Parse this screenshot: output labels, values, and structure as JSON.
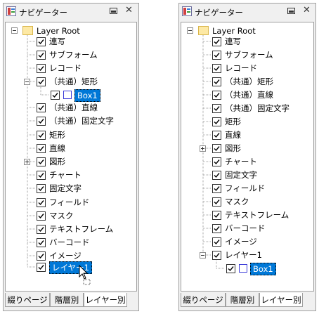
{
  "left_panel": {
    "title": "ナビゲーター",
    "root_label": "Layer Root",
    "items": [
      {
        "label": "連写"
      },
      {
        "label": "サブフォーム"
      },
      {
        "label": "レコード"
      },
      {
        "label": "（共通）矩形"
      },
      {
        "label": "Box1"
      },
      {
        "label": "（共通）直線"
      },
      {
        "label": "（共通）固定文字"
      },
      {
        "label": "矩形"
      },
      {
        "label": "直線"
      },
      {
        "label": "図形"
      },
      {
        "label": "チャート"
      },
      {
        "label": "固定文字"
      },
      {
        "label": "フィールド"
      },
      {
        "label": "マスク"
      },
      {
        "label": "テキストフレーム"
      },
      {
        "label": "バーコード"
      },
      {
        "label": "イメージ"
      },
      {
        "label": "レイヤー1"
      }
    ],
    "tabs": [
      {
        "label": "綴りページ"
      },
      {
        "label": "階層別"
      },
      {
        "label": "レイヤー別"
      }
    ],
    "active_tab": "レイヤー別",
    "selected_item": "Box1"
  },
  "right_panel": {
    "title": "ナビゲーター",
    "root_label": "Layer Root",
    "items": [
      {
        "label": "連写"
      },
      {
        "label": "サブフォーム"
      },
      {
        "label": "レコード"
      },
      {
        "label": "（共通）矩形"
      },
      {
        "label": "（共通）直線"
      },
      {
        "label": "（共通）固定文字"
      },
      {
        "label": "矩形"
      },
      {
        "label": "直線"
      },
      {
        "label": "図形"
      },
      {
        "label": "チャート"
      },
      {
        "label": "固定文字"
      },
      {
        "label": "フィールド"
      },
      {
        "label": "マスク"
      },
      {
        "label": "テキストフレーム"
      },
      {
        "label": "バーコード"
      },
      {
        "label": "イメージ"
      },
      {
        "label": "レイヤー1"
      },
      {
        "label": "Box1"
      }
    ],
    "tabs": [
      {
        "label": "綴りページ"
      },
      {
        "label": "階層別"
      },
      {
        "label": "レイヤー別"
      }
    ],
    "active_tab": "レイヤー別",
    "selected_item": "Box1"
  },
  "colors": {
    "selection": "#0078d7",
    "rect_icon": "#3a3ad8",
    "folder": "#fde9a5"
  },
  "icons": {
    "app": "navigator-app-icon",
    "dock": "dock-icon",
    "close": "close-icon",
    "cursor": "mouse-pointer-icon"
  }
}
